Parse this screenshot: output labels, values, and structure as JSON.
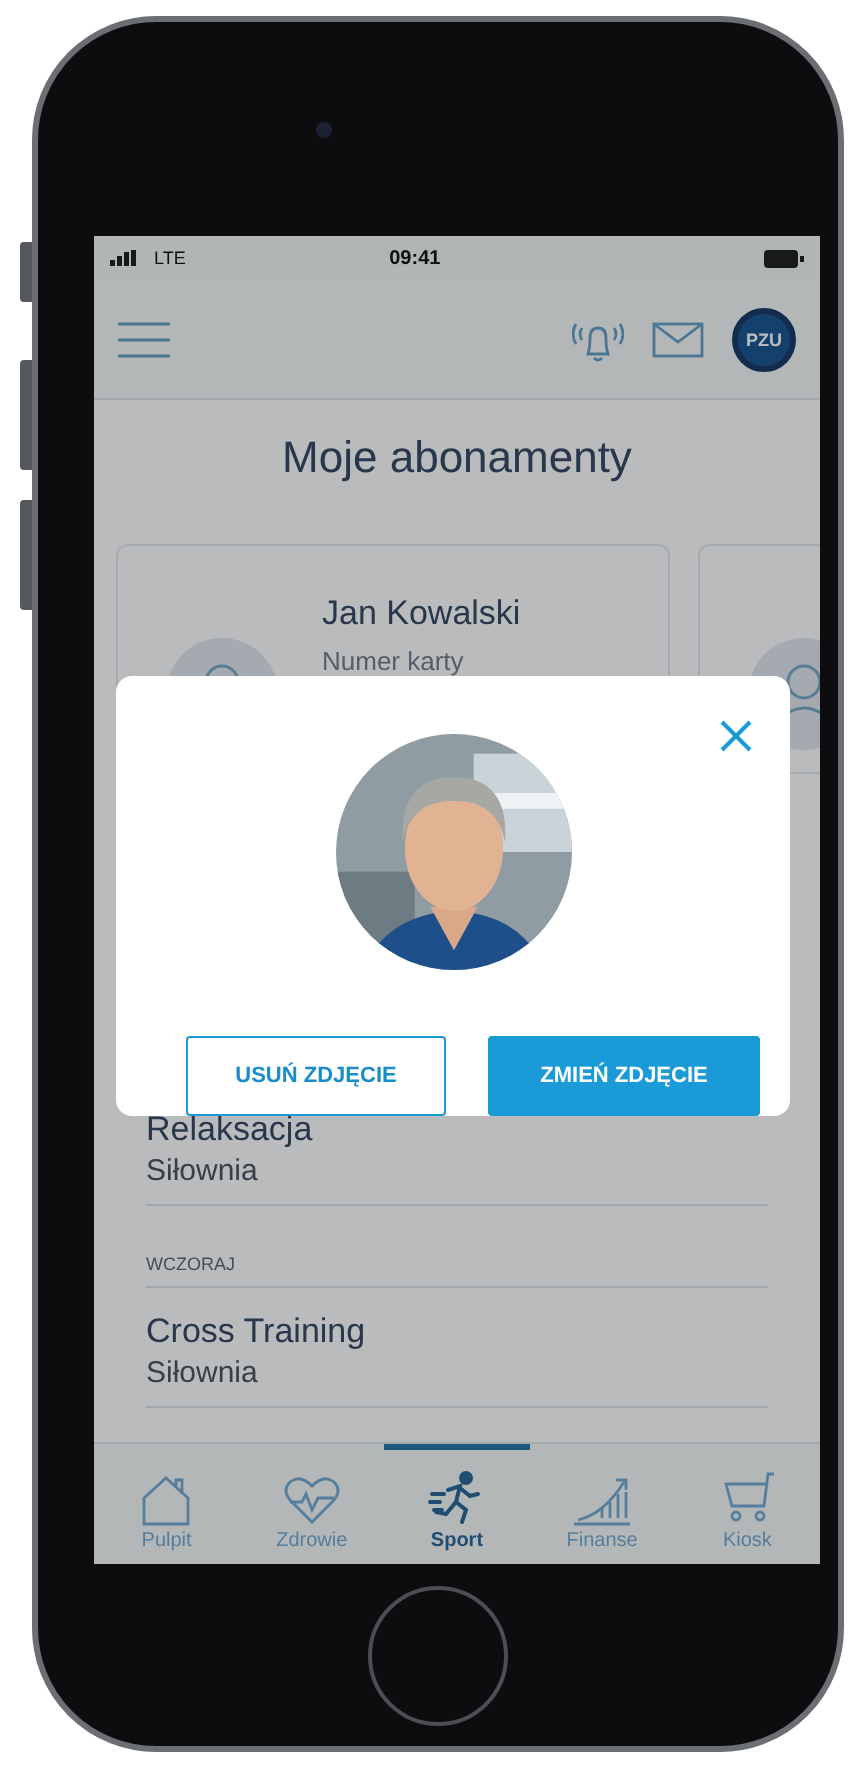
{
  "status_bar": {
    "carrier": "LTE",
    "time": "09:41"
  },
  "header": {
    "logo": "PZU"
  },
  "title": "Moje abonamenty",
  "cards": [
    {
      "kind": "person",
      "name": "Jan Kowalski",
      "label": "Numer karty"
    },
    {
      "kind": "peek"
    }
  ],
  "list": [
    {
      "title": "Relaksacja",
      "subtitle": "Siłownia"
    },
    {
      "heading": "WCZORAJ"
    },
    {
      "title": "Cross Training",
      "subtitle": "Siłownia"
    }
  ],
  "modal": {
    "buttons": [
      {
        "label": "USUŃ ZDJĘCIE",
        "kind": "outline"
      },
      {
        "label": "ZMIEŃ ZDJĘCIE",
        "kind": "primary"
      }
    ]
  },
  "tabs": [
    {
      "label": "Pulpit",
      "selected": false
    },
    {
      "label": "Zdrowie",
      "selected": false
    },
    {
      "label": "Sport",
      "selected": true
    },
    {
      "label": "Finanse",
      "selected": false
    },
    {
      "label": "Kiosk",
      "selected": false
    }
  ]
}
